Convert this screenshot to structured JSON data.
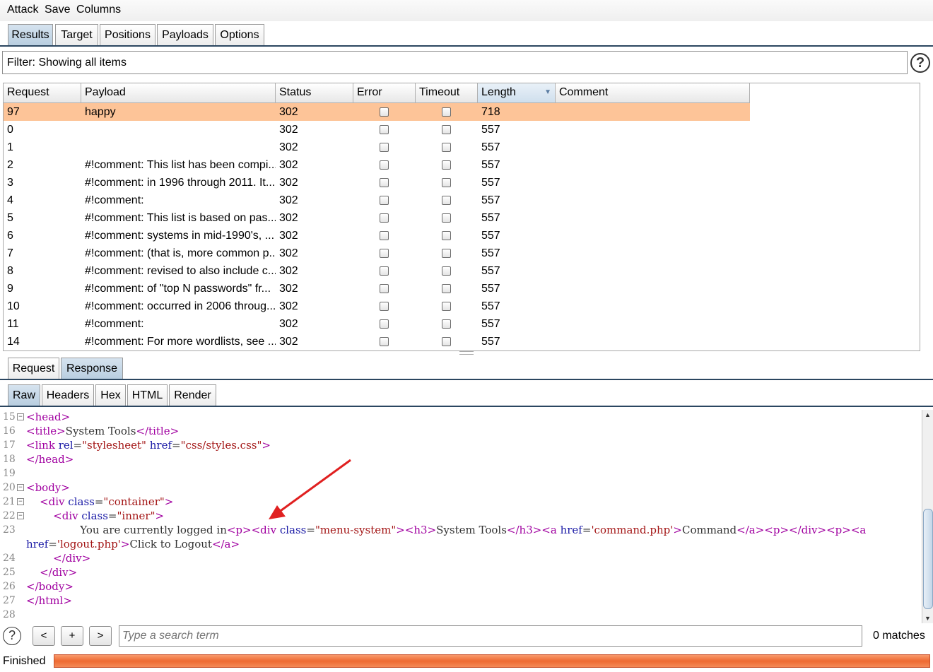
{
  "menu": [
    "Attack",
    "Save",
    "Columns"
  ],
  "tabs": [
    "Results",
    "Target",
    "Positions",
    "Payloads",
    "Options"
  ],
  "filter_text": "Filter: Showing all items",
  "columns": [
    "Request",
    "Payload",
    "Status",
    "Error",
    "Timeout",
    "Length",
    "Comment"
  ],
  "sorted_column": "Length",
  "rows": [
    {
      "request": "97",
      "payload": "happy",
      "status": "302",
      "error": false,
      "timeout": false,
      "length": "718",
      "comment": "",
      "selected": true
    },
    {
      "request": "0",
      "payload": "",
      "status": "302",
      "error": false,
      "timeout": false,
      "length": "557",
      "comment": ""
    },
    {
      "request": "1",
      "payload": "",
      "status": "302",
      "error": false,
      "timeout": false,
      "length": "557",
      "comment": ""
    },
    {
      "request": "2",
      "payload": "#!comment: This list has been compi...",
      "status": "302",
      "error": false,
      "timeout": false,
      "length": "557",
      "comment": ""
    },
    {
      "request": "3",
      "payload": "#!comment: in 1996 through 2011.  It...",
      "status": "302",
      "error": false,
      "timeout": false,
      "length": "557",
      "comment": ""
    },
    {
      "request": "4",
      "payload": "#!comment:",
      "status": "302",
      "error": false,
      "timeout": false,
      "length": "557",
      "comment": ""
    },
    {
      "request": "5",
      "payload": "#!comment: This list is based on pas...",
      "status": "302",
      "error": false,
      "timeout": false,
      "length": "557",
      "comment": ""
    },
    {
      "request": "6",
      "payload": "#!comment: systems in mid-1990's, ...",
      "status": "302",
      "error": false,
      "timeout": false,
      "length": "557",
      "comment": ""
    },
    {
      "request": "7",
      "payload": "#!comment: (that is, more common p...",
      "status": "302",
      "error": false,
      "timeout": false,
      "length": "557",
      "comment": ""
    },
    {
      "request": "8",
      "payload": "#!comment: revised to also include c...",
      "status": "302",
      "error": false,
      "timeout": false,
      "length": "557",
      "comment": ""
    },
    {
      "request": "9",
      "payload": "#!comment: of \"top N passwords\" fr...",
      "status": "302",
      "error": false,
      "timeout": false,
      "length": "557",
      "comment": ""
    },
    {
      "request": "10",
      "payload": "#!comment: occurred in 2006 throug...",
      "status": "302",
      "error": false,
      "timeout": false,
      "length": "557",
      "comment": ""
    },
    {
      "request": "11",
      "payload": "#!comment:",
      "status": "302",
      "error": false,
      "timeout": false,
      "length": "557",
      "comment": ""
    },
    {
      "request": "14",
      "payload": "#!comment: For more wordlists, see ...",
      "status": "302",
      "error": false,
      "timeout": false,
      "length": "557",
      "comment": ""
    }
  ],
  "message_tabs": [
    "Request",
    "Response"
  ],
  "view_tabs": [
    "Raw",
    "Headers",
    "Hex",
    "HTML",
    "Render"
  ],
  "code_lines": [
    {
      "n": "15",
      "fold": true,
      "parts": [
        [
          "tg",
          "<head>"
        ]
      ]
    },
    {
      "n": "16",
      "fold": false,
      "parts": [
        [
          "tg",
          "<title>"
        ],
        [
          "tx",
          "System Tools"
        ],
        [
          "tg",
          "</title>"
        ]
      ]
    },
    {
      "n": "17",
      "fold": false,
      "parts": [
        [
          "tg",
          "<link "
        ],
        [
          "at",
          "rel"
        ],
        [
          "tx",
          "="
        ],
        [
          "vl",
          "\"stylesheet\""
        ],
        [
          "tx",
          " "
        ],
        [
          "at",
          "href"
        ],
        [
          "tx",
          "="
        ],
        [
          "vl",
          "\"css/styles.css\""
        ],
        [
          "tg",
          ">"
        ]
      ]
    },
    {
      "n": "18",
      "fold": false,
      "parts": [
        [
          "tg",
          "</head>"
        ]
      ]
    },
    {
      "n": "19",
      "fold": false,
      "parts": []
    },
    {
      "n": "20",
      "fold": true,
      "parts": [
        [
          "tg",
          "<body>"
        ]
      ]
    },
    {
      "n": "21",
      "fold": true,
      "parts": [
        [
          "tx",
          "    "
        ],
        [
          "tg",
          "<div "
        ],
        [
          "at",
          "class"
        ],
        [
          "tx",
          "="
        ],
        [
          "vl",
          "\"container\""
        ],
        [
          "tg",
          ">"
        ]
      ]
    },
    {
      "n": "22",
      "fold": true,
      "parts": [
        [
          "tx",
          "        "
        ],
        [
          "tg",
          "<div "
        ],
        [
          "at",
          "class"
        ],
        [
          "tx",
          "="
        ],
        [
          "vl",
          "\"inner\""
        ],
        [
          "tg",
          ">"
        ]
      ]
    },
    {
      "n": "23",
      "fold": false,
      "parts": [
        [
          "tx",
          "                You are currently logged in"
        ],
        [
          "tg",
          "<p><div "
        ],
        [
          "at",
          "class"
        ],
        [
          "tx",
          "="
        ],
        [
          "vl",
          "\"menu-system\""
        ],
        [
          "tg",
          "><h3>"
        ],
        [
          "tx",
          "System Tools"
        ],
        [
          "tg",
          "</h3><a "
        ],
        [
          "at",
          "href"
        ],
        [
          "tx",
          "="
        ],
        [
          "vl",
          "'command.php'"
        ],
        [
          "tg",
          ">"
        ],
        [
          "tx",
          "Command"
        ],
        [
          "tg",
          "</a><p></div><p><a"
        ]
      ]
    },
    {
      "n": "",
      "fold": false,
      "parts": [
        [
          "at",
          "href"
        ],
        [
          "tx",
          "="
        ],
        [
          "vl",
          "'logout.php'"
        ],
        [
          "tg",
          ">"
        ],
        [
          "tx",
          "Click to Logout"
        ],
        [
          "tg",
          "</a>"
        ]
      ]
    },
    {
      "n": "24",
      "fold": false,
      "parts": [
        [
          "tx",
          "        "
        ],
        [
          "tg",
          "</div>"
        ]
      ]
    },
    {
      "n": "25",
      "fold": false,
      "parts": [
        [
          "tx",
          "    "
        ],
        [
          "tg",
          "</div>"
        ]
      ]
    },
    {
      "n": "26",
      "fold": false,
      "parts": [
        [
          "tg",
          "</body>"
        ]
      ]
    },
    {
      "n": "27",
      "fold": false,
      "parts": [
        [
          "tg",
          "</html>"
        ]
      ]
    },
    {
      "n": "28",
      "fold": false,
      "parts": []
    }
  ],
  "search": {
    "prev": "<",
    "add": "+",
    "next": ">",
    "placeholder": "Type a search term",
    "matches": "0 matches"
  },
  "status": {
    "text": "Finished",
    "progress": 1.0
  },
  "colors": {
    "selected_row": "#fdc498",
    "progress": "#ee6a32",
    "arrow": "#e02020",
    "tab_active": "#b9cee0"
  }
}
